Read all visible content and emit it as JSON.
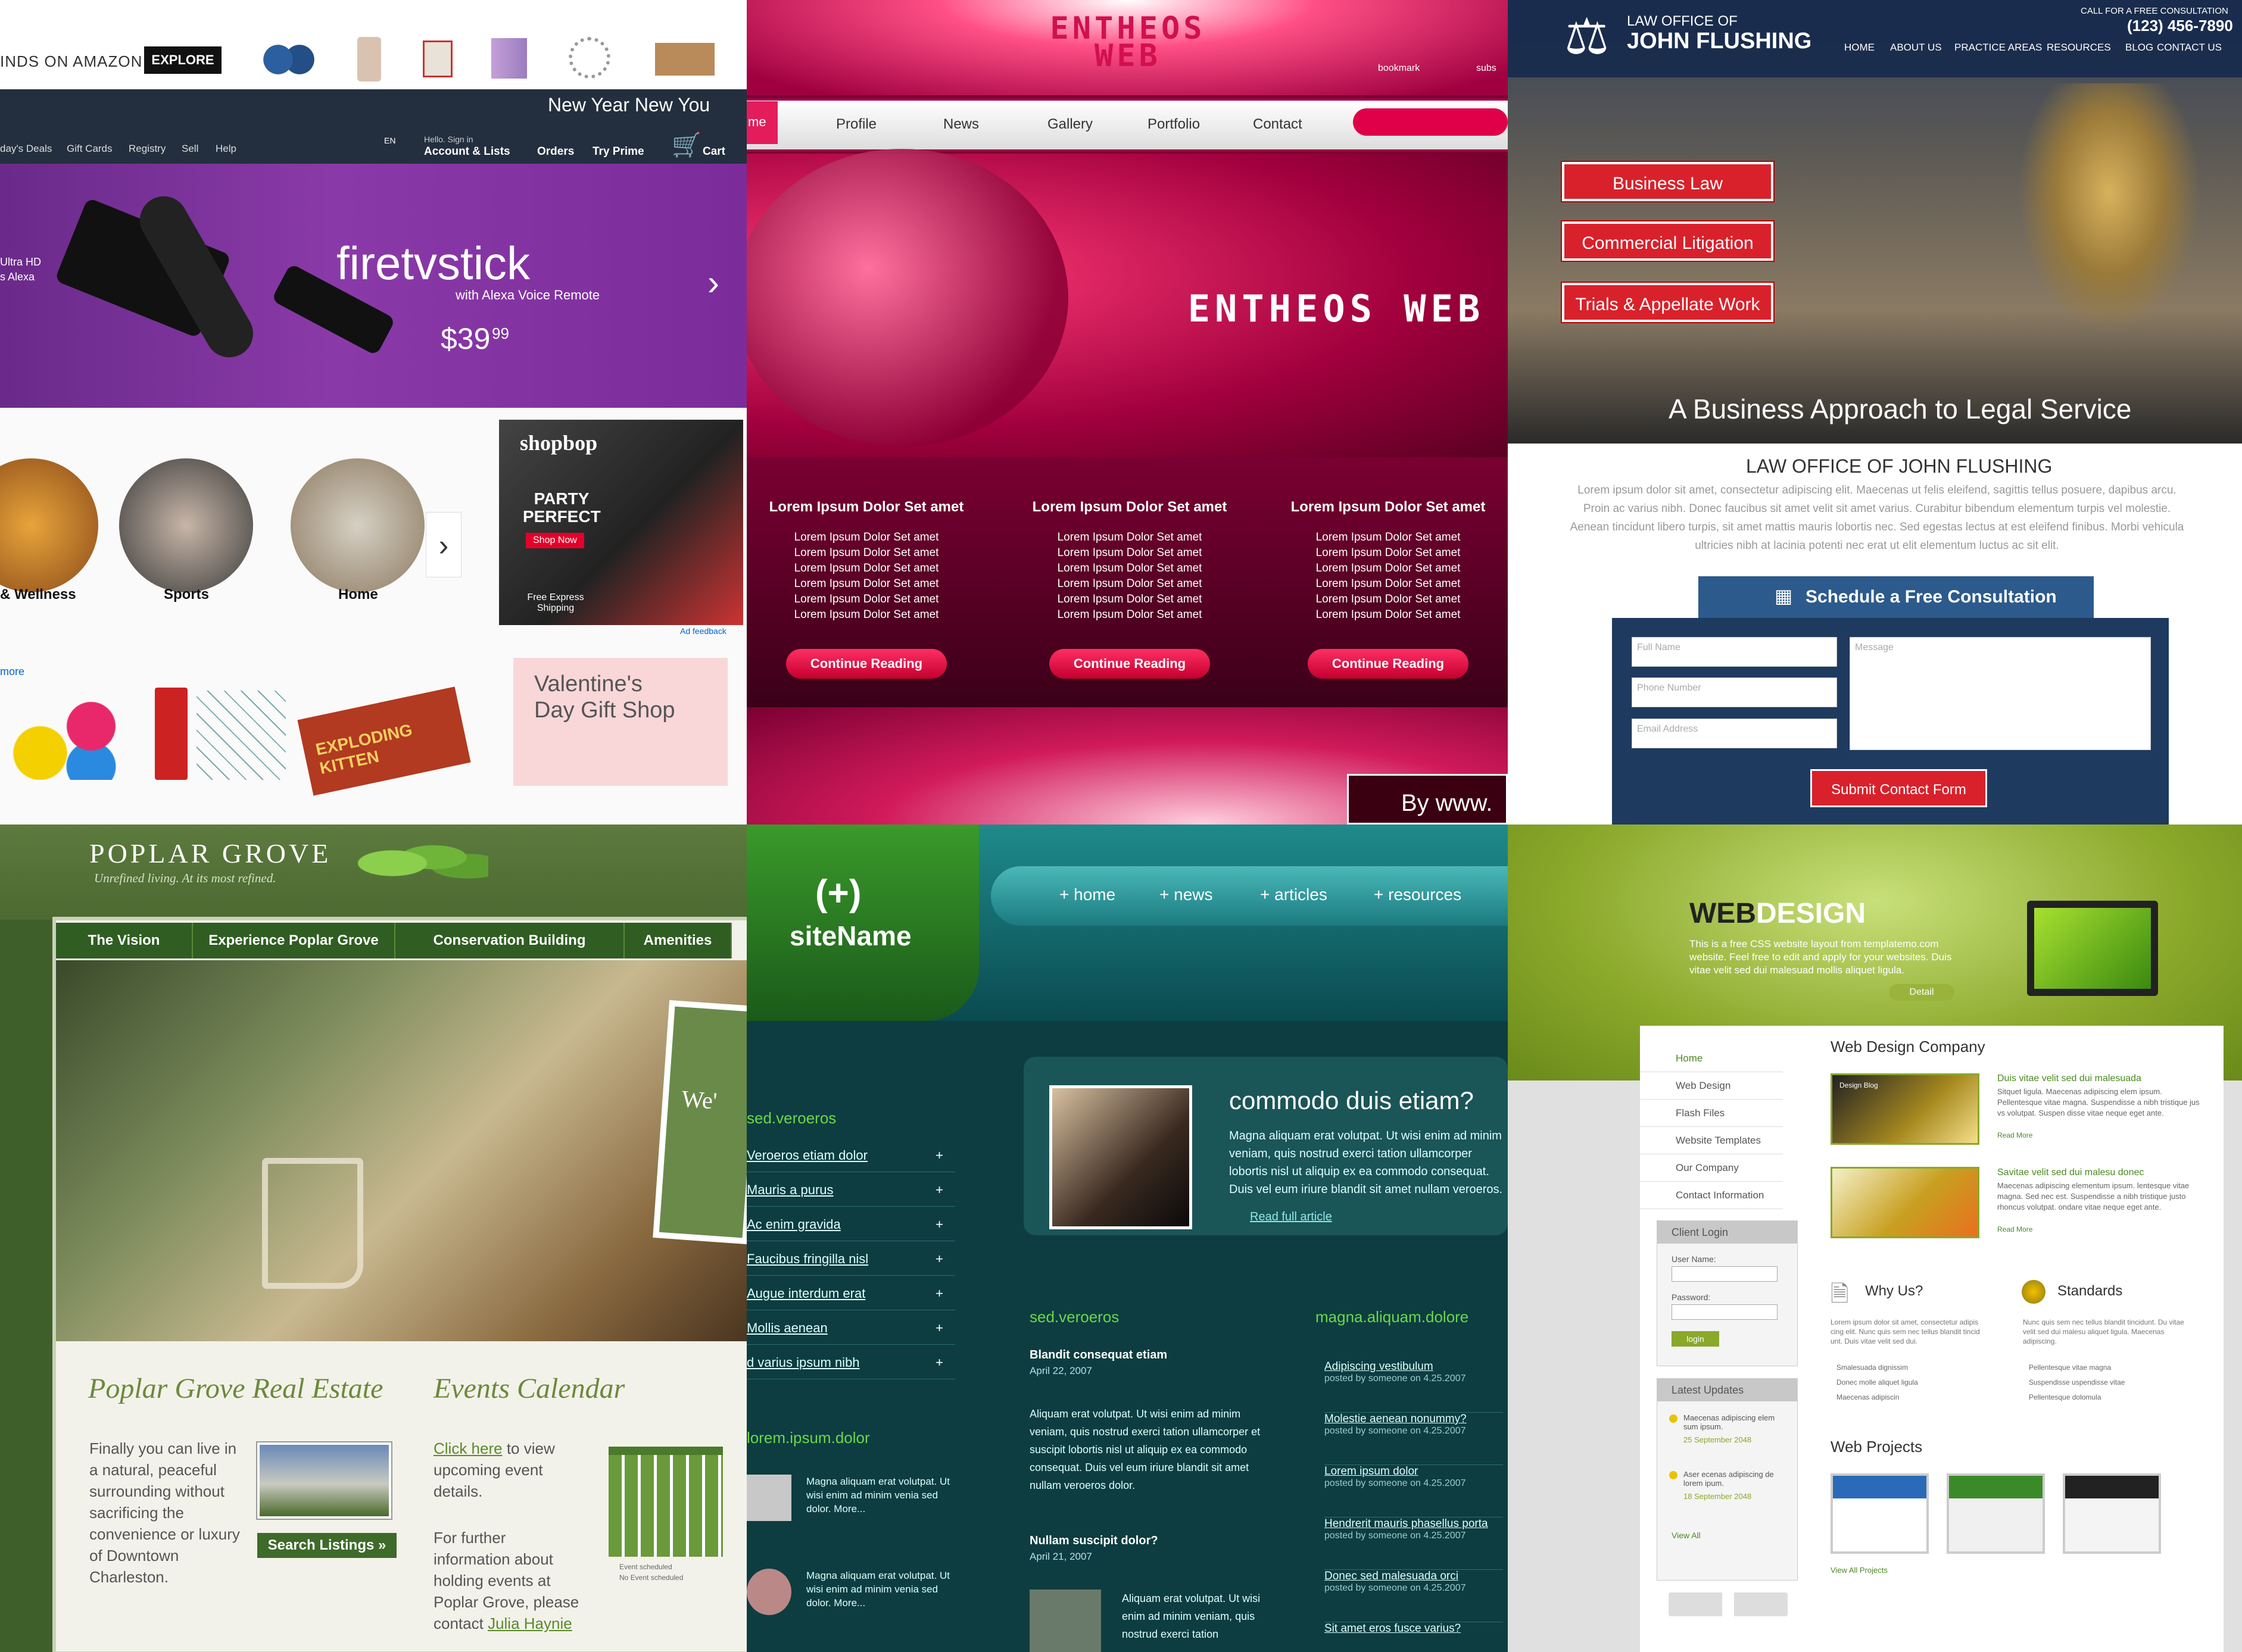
{
  "amazon": {
    "finds_label": "INDS ON AMAZON",
    "explore": "EXPLORE",
    "promo": "New Year New You",
    "nav_links": [
      "day's Deals",
      "Gift Cards",
      "Registry",
      "Sell",
      "Help"
    ],
    "lang": "EN",
    "account_small": "Hello. Sign in",
    "account": "Account & Lists",
    "orders": "Orders",
    "prime": "Try Prime",
    "cart": "Cart",
    "hero_side": [
      "Ultra HD",
      "s Alexa"
    ],
    "hero_title": "firetvstick",
    "hero_sub": "with Alexa Voice Remote",
    "hero_price": "$39",
    "hero_cents": "99",
    "categories": [
      "& Wellness",
      "Sports",
      "Home"
    ],
    "shopbop": "shopbop",
    "party": "PARTY PERFECT",
    "shop_now": "Shop Now",
    "free_ship": "Free Express Shipping",
    "ad_feedback": "Ad feedback",
    "more": "more",
    "valentine": "Valentine's Day Gift Shop",
    "kitten": "EXPLODING KITTEN"
  },
  "entheos": {
    "logo": "ENTHEOS WEB",
    "bookmark": "bookmark",
    "subscribe": "subs",
    "nav": [
      "me",
      "Profile",
      "News",
      "Gallery",
      "Portfolio",
      "Contact"
    ],
    "columns": [
      {
        "title": "Lorem Ipsum Dolor Set amet",
        "lines": [
          "Lorem Ipsum Dolor Set amet",
          "Lorem Ipsum Dolor Set amet",
          "Lorem Ipsum Dolor Set amet",
          "Lorem Ipsum Dolor Set amet",
          "Lorem Ipsum Dolor Set amet",
          "Lorem Ipsum Dolor Set amet"
        ],
        "button": "Continue Reading"
      },
      {
        "title": "Lorem Ipsum Dolor Set amet",
        "lines": [
          "Lorem Ipsum Dolor Set amet",
          "Lorem Ipsum Dolor Set amet",
          "Lorem Ipsum Dolor Set amet",
          "Lorem Ipsum Dolor Set amet",
          "Lorem Ipsum Dolor Set amet",
          "Lorem Ipsum Dolor Set amet"
        ],
        "button": "Continue Reading"
      },
      {
        "title": "Lorem Ipsum Dolor Set amet",
        "lines": [
          "Lorem Ipsum Dolor Set amet",
          "Lorem Ipsum Dolor Set amet",
          "Lorem Ipsum Dolor Set amet",
          "Lorem Ipsum Dolor Set amet",
          "Lorem Ipsum Dolor Set amet",
          "Lorem Ipsum Dolor Set amet"
        ],
        "button": "Continue Reading"
      }
    ],
    "byline": "By www."
  },
  "law": {
    "logo_small": "LAW OFFICE OF",
    "logo_big": "JOHN FLUSHING",
    "call": "CALL FOR A FREE CONSULTATION",
    "phone": "(123) 456-7890",
    "nav": [
      "HOME",
      "ABOUT US",
      "PRACTICE AREAS",
      "RESOURCES",
      "BLOG",
      "CONTACT US"
    ],
    "buttons": [
      "Business Law",
      "Commercial Litigation",
      "Trials & Appellate Work"
    ],
    "tagline": "A Business Approach to Legal Service",
    "heading": "LAW OFFICE OF JOHN FLUSHING",
    "body": "Lorem ipsum dolor sit amet, consectetur adipiscing elit. Maecenas ut felis eleifend, sagittis tellus posuere, dapibus arcu. Proin ac varius nibh. Donec faucibus sit amet velit sit amet varius. Curabitur bibendum elementum turpis vel molestie. Aenean tincidunt libero turpis, sit amet mattis mauris lobortis nec. Sed egestas lectus at est eleifend finibus. Morbi vehicula ultricies nibh at lacinia potenti nec erat ut elit elementum luctus ac sit elit.",
    "schedule": "Schedule a Free Consultation",
    "fields": {
      "name": "Full Name",
      "phone": "Phone Number",
      "email": "Email Address",
      "message": "Message"
    },
    "submit": "Submit Contact Form"
  },
  "poplar": {
    "logo": "POPLAR GROVE",
    "tagline": "Unrefined living. At its most refined.",
    "tabs": [
      "The Vision",
      "Experience Poplar Grove",
      "Conservation Building",
      "Amenities"
    ],
    "welcome": "We'",
    "re_heading": "Poplar Grove Real Estate",
    "re_body": "Finally you can live in a natural, peaceful surrounding without sacrificing the convenience or luxury of Downtown Charleston.",
    "search": "Search Listings »",
    "ev_heading": "Events Calendar",
    "ev_link": "Click here",
    "ev_body": " to view upcoming event details.",
    "ev_body2": "For further information about holding events at Poplar Grove, please contact ",
    "ev_contact": "Julia Haynie",
    "cal_legend": [
      "Event scheduled",
      "No Event scheduled"
    ]
  },
  "sitename": {
    "logo_mark": "(+)",
    "logo": "siteName",
    "nav": [
      "home",
      "news",
      "articles",
      "resources"
    ],
    "side_heading": "sed.veroeros",
    "links": [
      "Veroeros etiam dolor",
      "Mauris a purus",
      "Ac enim gravida",
      "Faucibus fringilla nisl",
      "Augue interdum erat",
      "Mollis aenean",
      "d varius ipsum nibh"
    ],
    "feature_title": "commodo duis etiam?",
    "feature_body": "Magna aliquam erat volutpat. Ut wisi enim ad minim veniam, quis nostrud exerci tation ullamcorper lobortis nisl ut aliquip ex ea commodo consequat. Duis vel eum iriure blandit sit amet nullam veroeros.",
    "read_more": "Read full article",
    "lorem_heading": "lorem.ipsum.dolor",
    "lorem_items": [
      "Magna aliquam erat volutpat. Ut wisi enim ad minim venia sed dolor. More...",
      "Magna aliquam erat volutpat. Ut wisi enim ad minim venia sed dolor. More..."
    ],
    "mid_heading": "sed.veroeros",
    "posts": [
      {
        "title": "Blandit consequat etiam",
        "date": "April 22, 2007",
        "body": "Aliquam erat volutpat. Ut wisi enim ad minim veniam, quis nostrud exerci tation ullamcorper et suscipit lobortis nisl ut aliquip ex ea commodo consequat. Duis vel eum iriure blandit sit amet nullam veroeros dolor."
      },
      {
        "title": "Nullam suscipit dolor?",
        "date": "April 21, 2007",
        "body": "Aliquam erat volutpat. Ut wisi enim ad minim veniam, quis nostrud exerci tation"
      }
    ],
    "right_heading": "magna.aliquam.dolore",
    "right_items": [
      "Adipiscing vestibulum",
      "Molestie aenean nonummy?",
      "Lorem ipsum dolor",
      "Hendrerit mauris phasellus porta",
      "Donec sed malesuada orci",
      "Sit amet eros fusce varius?"
    ],
    "posted": "posted by someone on 4.25.2007"
  },
  "webdesign": {
    "title_a": "WEB",
    "title_b": "DESIGN",
    "intro": "This is a free CSS website layout from templatemo.com website. Feel free to edit and apply for your websites. Duis vitae velit sed dui malesuad mollis aliquet ligula.",
    "detail": "Detail",
    "menu": [
      "Home",
      "Web Design",
      "Flash Files",
      "Website Templates",
      "Our Company",
      "Contact Information"
    ],
    "login_heading": "Client Login",
    "user": "User Name:",
    "pass": "Password:",
    "login": "login",
    "updates_heading": "Latest Updates",
    "updates": [
      {
        "text": "Maecenas adipiscing elem sum ipsum.",
        "date": "25 September 2048"
      },
      {
        "text": "Aser ecenas adipiscing de lorem ipum.",
        "date": "18 September 2048"
      }
    ],
    "view_all": "View All",
    "company": "Web Design Company",
    "items": [
      {
        "title": "Duis vitae velit sed dui malesuada",
        "body": "Sitquet ligula. Maecenas adipiscing elem ipsum. Pellentesque vitae magna. Suspendisse a nibh tristique jus vs volutpat. Suspen disse vitae neque eget ante.",
        "more": "Read More"
      },
      {
        "title": "Savitae velit sed dui malesu donec",
        "body": "Maecenas adipiscing elementum ipsum. lentesque vitae magna. Sed nec est. Suspendisse a nibh tristique justo rhoncus volutpat. ondare vitae neque eget ante.",
        "more": "Read More"
      }
    ],
    "thumb1": "Design Blog",
    "why": "Why Us?",
    "standards": "Standards",
    "why_body": "Lorem ipsum dolor sit amet, consectetur adipis cing elit. Nunc quis sem nec tellus blandit tincid unt. Duis vitae velit sed dui.",
    "std_body": "Nunc quis sem nec tellus blandit tincidunt. Du vitae velit sed dui malesu aliquet ligula. Maecenas adipiscing.",
    "why_list": [
      "Smalesuada dignissim",
      "Donec molle aliquet ligula",
      "Maecenas adipiscin"
    ],
    "std_list": [
      "Pellentesque vitae magna",
      "Suspendisse uspendisse vitae",
      "Pellentesque dolomula"
    ],
    "projects": "Web Projects",
    "view_projects": "View All Projects"
  }
}
